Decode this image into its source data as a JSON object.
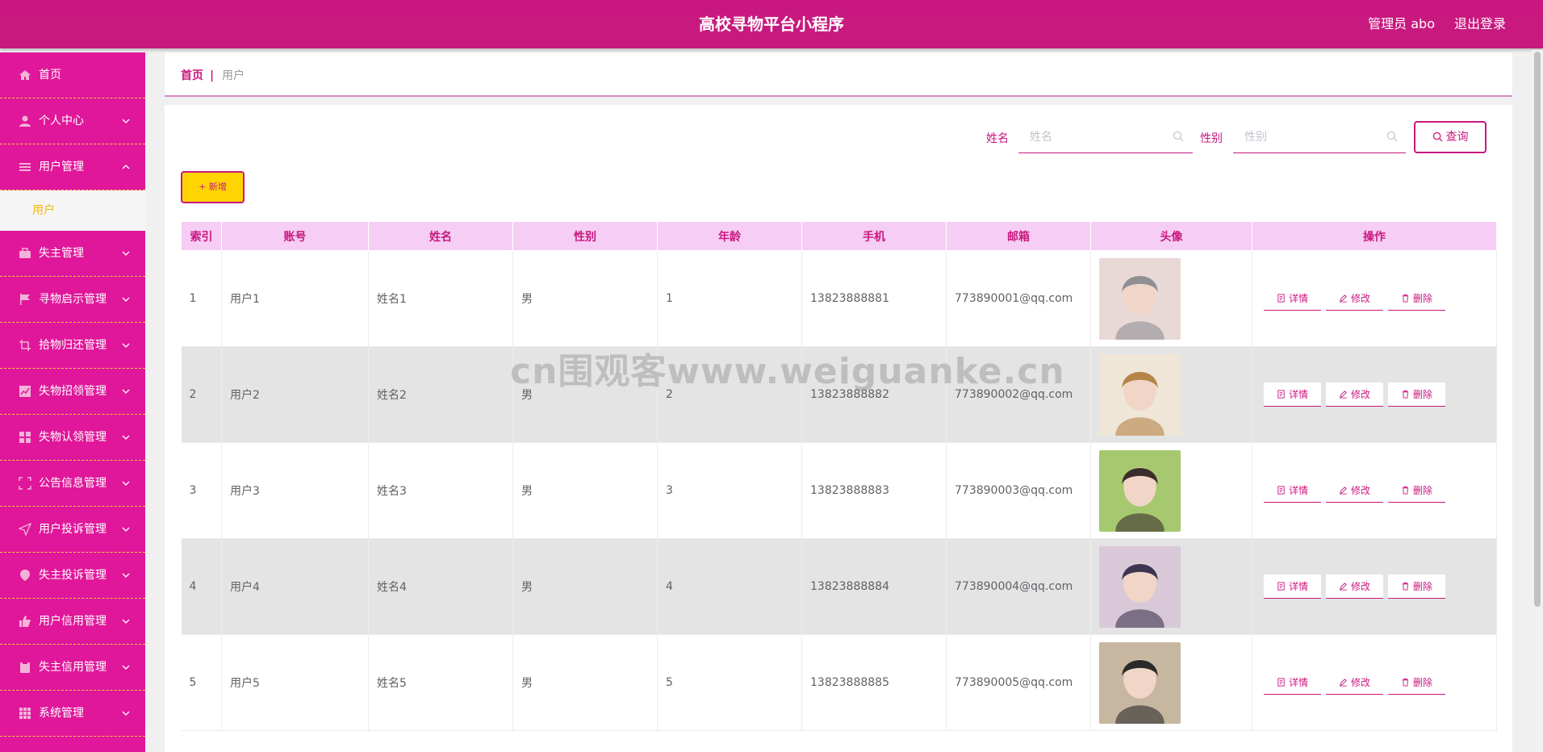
{
  "header": {
    "title": "高校寻物平台小程序",
    "admin_label": "管理员 abo",
    "logout_label": "退出登录"
  },
  "sidebar": {
    "items": [
      {
        "label": "首页",
        "icon": "home-icon",
        "expandable": false
      },
      {
        "label": "个人中心",
        "icon": "user-icon",
        "expandable": true
      },
      {
        "label": "用户管理",
        "icon": "list-icon",
        "expandable": true,
        "expanded": true
      },
      {
        "label": "失主管理",
        "icon": "briefcase-icon",
        "expandable": true
      },
      {
        "label": "寻物启示管理",
        "icon": "flag-icon",
        "expandable": true
      },
      {
        "label": "拾物归还管理",
        "icon": "crop-icon",
        "expandable": true
      },
      {
        "label": "失物招领管理",
        "icon": "chart-icon",
        "expandable": true
      },
      {
        "label": "失物认领管理",
        "icon": "grid-icon",
        "expandable": true
      },
      {
        "label": "公告信息管理",
        "icon": "fullscreen-icon",
        "expandable": true
      },
      {
        "label": "用户投诉管理",
        "icon": "send-icon",
        "expandable": true
      },
      {
        "label": "失主投诉管理",
        "icon": "location-icon",
        "expandable": true
      },
      {
        "label": "用户信用管理",
        "icon": "thumb-icon",
        "expandable": true
      },
      {
        "label": "失主信用管理",
        "icon": "clipboard-icon",
        "expandable": true
      },
      {
        "label": "系统管理",
        "icon": "apps-icon",
        "expandable": true
      }
    ],
    "submenu_label": "用户"
  },
  "breadcrumb": {
    "home": "首页",
    "separator": "|",
    "current": "用户"
  },
  "search": {
    "name_label": "姓名",
    "name_placeholder": "姓名",
    "gender_label": "性别",
    "gender_placeholder": "性别",
    "query_label": "查询"
  },
  "add_label": "+ 新增",
  "table": {
    "headers": [
      "索引",
      "账号",
      "姓名",
      "性别",
      "年龄",
      "手机",
      "邮箱",
      "头像",
      "操作"
    ],
    "rows": [
      {
        "index": "1",
        "account": "用户1",
        "name": "姓名1",
        "gender": "男",
        "age": "1",
        "phone": "13823888881",
        "email": "773890001@qq.com"
      },
      {
        "index": "2",
        "account": "用户2",
        "name": "姓名2",
        "gender": "男",
        "age": "2",
        "phone": "13823888882",
        "email": "773890002@qq.com"
      },
      {
        "index": "3",
        "account": "用户3",
        "name": "姓名3",
        "gender": "男",
        "age": "3",
        "phone": "13823888883",
        "email": "773890003@qq.com"
      },
      {
        "index": "4",
        "account": "用户4",
        "name": "姓名4",
        "gender": "男",
        "age": "4",
        "phone": "13823888884",
        "email": "773890004@qq.com"
      },
      {
        "index": "5",
        "account": "用户5",
        "name": "姓名5",
        "gender": "男",
        "age": "5",
        "phone": "13823888885",
        "email": "773890005@qq.com"
      }
    ],
    "actions": {
      "detail": "详情",
      "edit": "修改",
      "delete": "删除"
    }
  },
  "watermark": "cn围观客www.weiguanke.cn",
  "colors": {
    "primary": "#c8187f",
    "sidebar": "#e0179a",
    "accent_yellow": "#ffd400",
    "header_row": "#f6cdf5"
  }
}
